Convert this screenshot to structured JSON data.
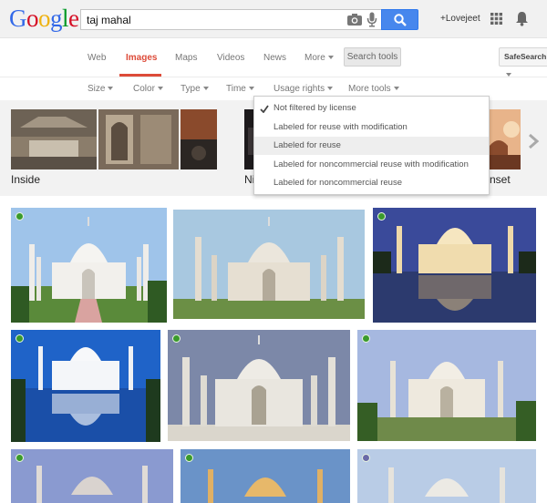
{
  "header": {
    "logo": "Google",
    "logo_colors": [
      "#3369e8",
      "#d50f25",
      "#eeb211",
      "#3369e8",
      "#009925",
      "#d50f25"
    ],
    "query": "taj mahal",
    "user": "+Lovejeet"
  },
  "nav": {
    "tabs": [
      "Web",
      "Images",
      "Maps",
      "Videos",
      "News",
      "More"
    ],
    "active_tab": "Images",
    "search_tools": "Search tools",
    "safesearch": "SafeSearch"
  },
  "filters": [
    "Size",
    "Color",
    "Type",
    "Time",
    "Usage rights",
    "More tools"
  ],
  "related": {
    "labels": [
      "Inside",
      "Ni",
      "nset"
    ]
  },
  "usage_rights_menu": {
    "selected": "Not filtered by license",
    "hovered": "Labeled for reuse",
    "options": [
      "Not filtered by license",
      "Labeled for reuse with modification",
      "Labeled for reuse",
      "Labeled for noncommercial reuse with modification",
      "Labeled for noncommercial reuse"
    ]
  },
  "colors": {
    "accent_red": "#dd4b39",
    "search_blue": "#4787ed",
    "license_dot_green": "#3a9a2c"
  }
}
